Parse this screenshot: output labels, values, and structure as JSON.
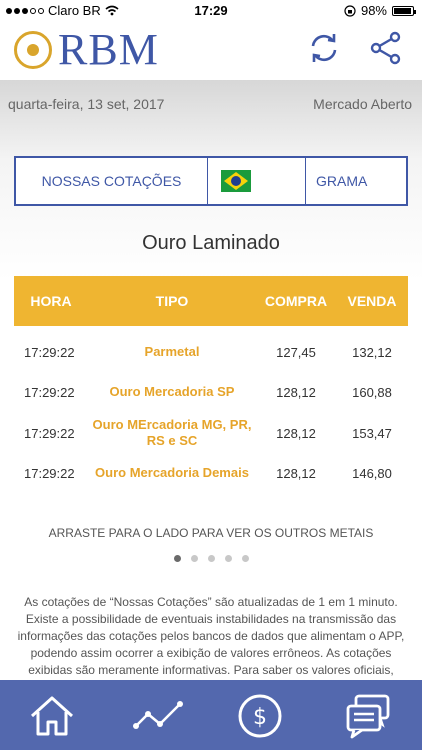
{
  "status_bar": {
    "carrier": "Claro BR",
    "time": "17:29",
    "battery": "98%"
  },
  "header": {
    "logo_text": "RBM"
  },
  "date_row": {
    "date": "quarta-feira, 13 set, 2017",
    "market_status": "Mercado Aberto"
  },
  "selector": {
    "label": "NOSSAS COTAÇÕES",
    "country": "Brasil",
    "unit": "GRAMA"
  },
  "section_title": "Ouro Laminado",
  "table": {
    "headers": {
      "hora": "HORA",
      "tipo": "TIPO",
      "compra": "COMPRA",
      "venda": "VENDA"
    },
    "rows": [
      {
        "hora": "17:29:22",
        "tipo": "Parmetal",
        "compra": "127,45",
        "venda": "132,12"
      },
      {
        "hora": "17:29:22",
        "tipo": "Ouro Mercadoria SP",
        "compra": "128,12",
        "venda": "160,88"
      },
      {
        "hora": "17:29:22",
        "tipo": "Ouro MErcadoria MG, PR, RS e SC",
        "compra": "128,12",
        "venda": "153,47"
      },
      {
        "hora": "17:29:22",
        "tipo": "Ouro Mercadoria Demais",
        "compra": "128,12",
        "venda": "146,80"
      }
    ]
  },
  "hint": "ARRASTE PARA O LADO PARA VER OS OUTROS METAIS",
  "pager": {
    "total": 5,
    "active": 1
  },
  "disclaimer": "As cotações de “Nossas Cotações” são atualizadas de 1 em 1 minuto. Existe a possibilidade de eventuais instabilidades na transmissão das informações das cotações pelos bancos de dados que alimentam o APP, podendo assim ocorrer a exibição de valores errôneos. As cotações exibidas são meramente informativas. Para saber os valores oficiais,",
  "colors": {
    "brand_blue": "#3f57a6",
    "gold": "#efb531",
    "nav_bg": "#5368ae"
  }
}
